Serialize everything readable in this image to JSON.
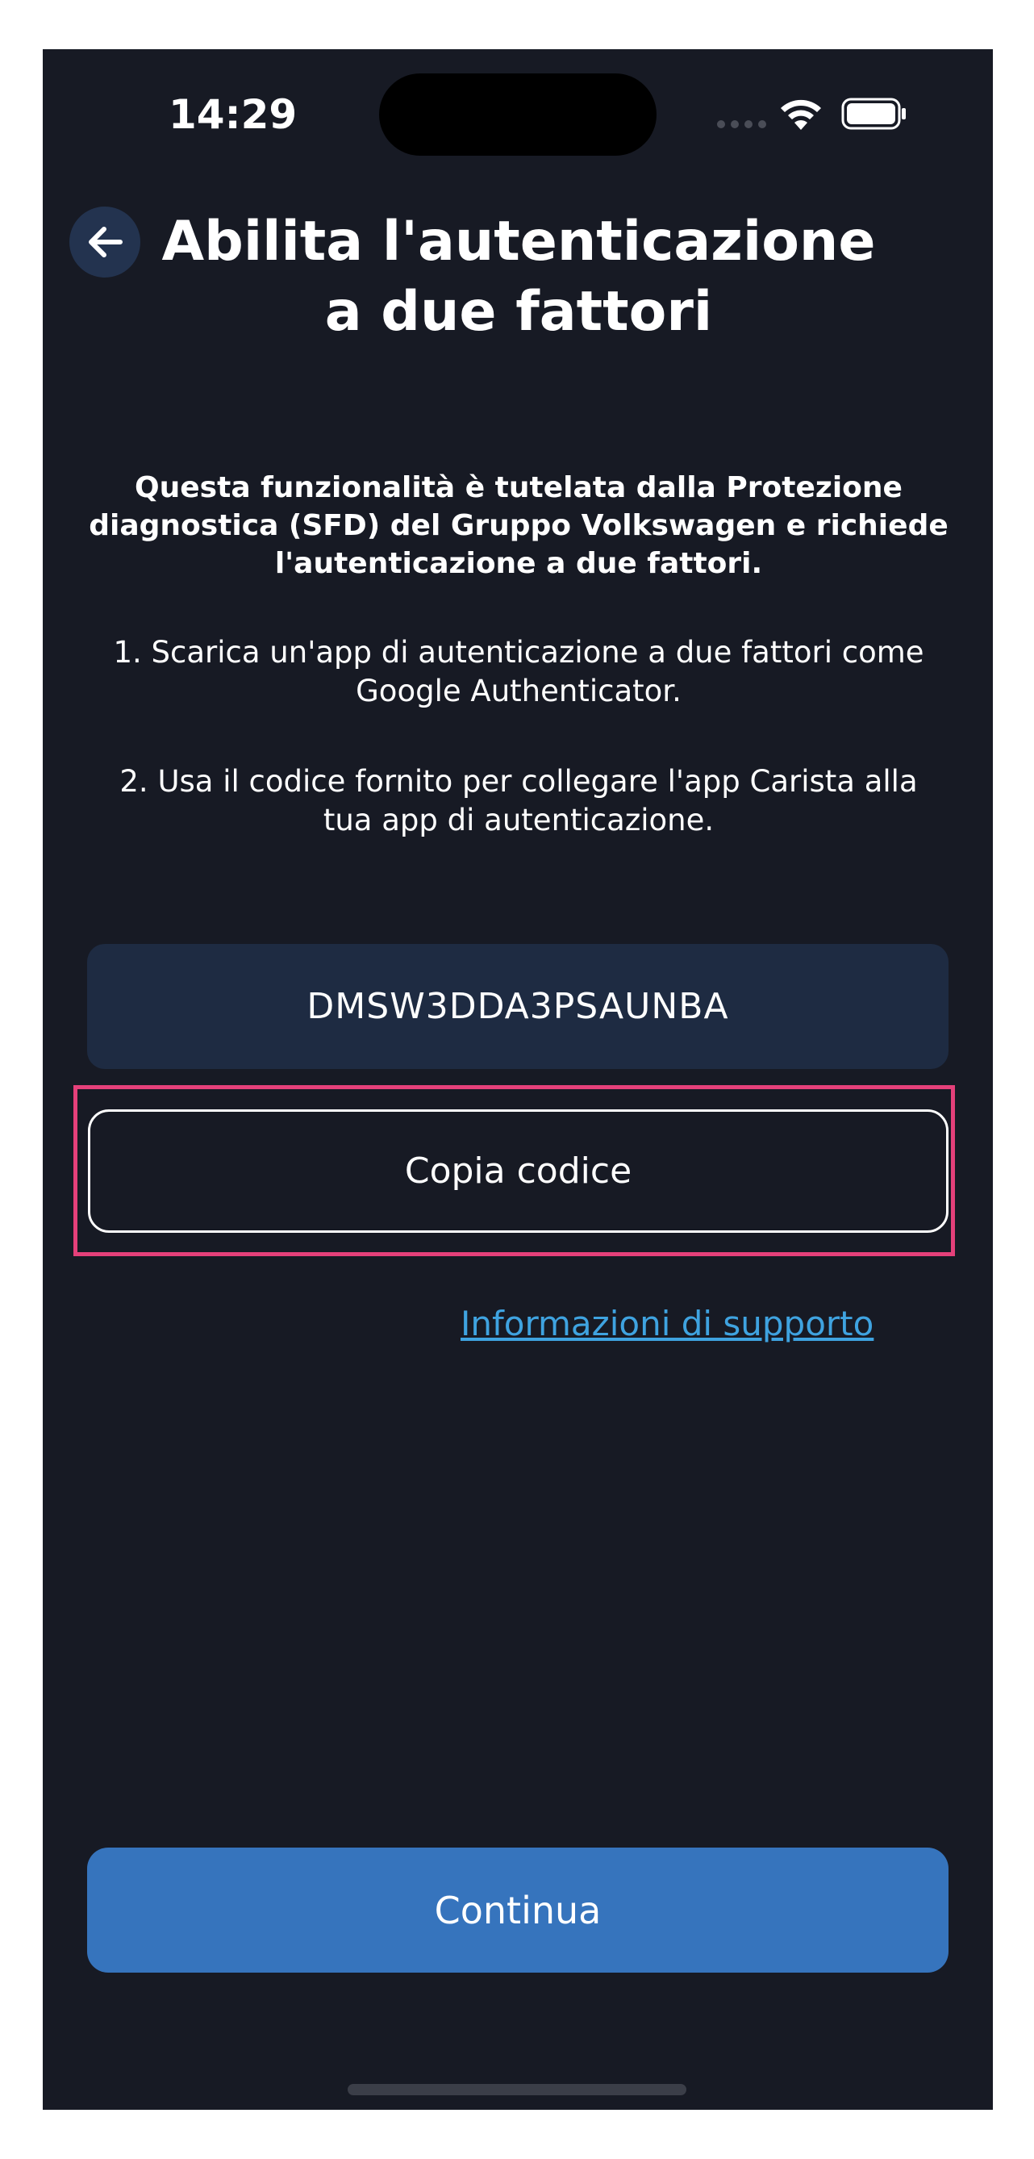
{
  "status_bar": {
    "time": "14:29"
  },
  "header": {
    "back_icon": "arrow-left-icon",
    "title": "Abilita l'autenticazione a due fattori"
  },
  "content": {
    "intro": "Questa funzionalità è tutelata dalla Protezione diagnostica (SFD) del Gruppo Volkswagen e richiede l'autenticazione a due fattori.",
    "step_1": "1. Scarica un'app di autenticazione a due fattori come Google Authenticator.",
    "step_2": "2. Usa il codice fornito per collegare l'app Carista alla tua app di autenticazione.",
    "code": "DMSW3DDA3PSAUNBA",
    "copy_label": "Copia codice",
    "support_link": "Informazioni di supporto"
  },
  "footer": {
    "continue_label": "Continua"
  },
  "colors": {
    "background": "#171a24",
    "code_box": "#1e2b42",
    "primary": "#3674bd",
    "link": "#3fa3e0",
    "highlight": "#e5407a"
  }
}
